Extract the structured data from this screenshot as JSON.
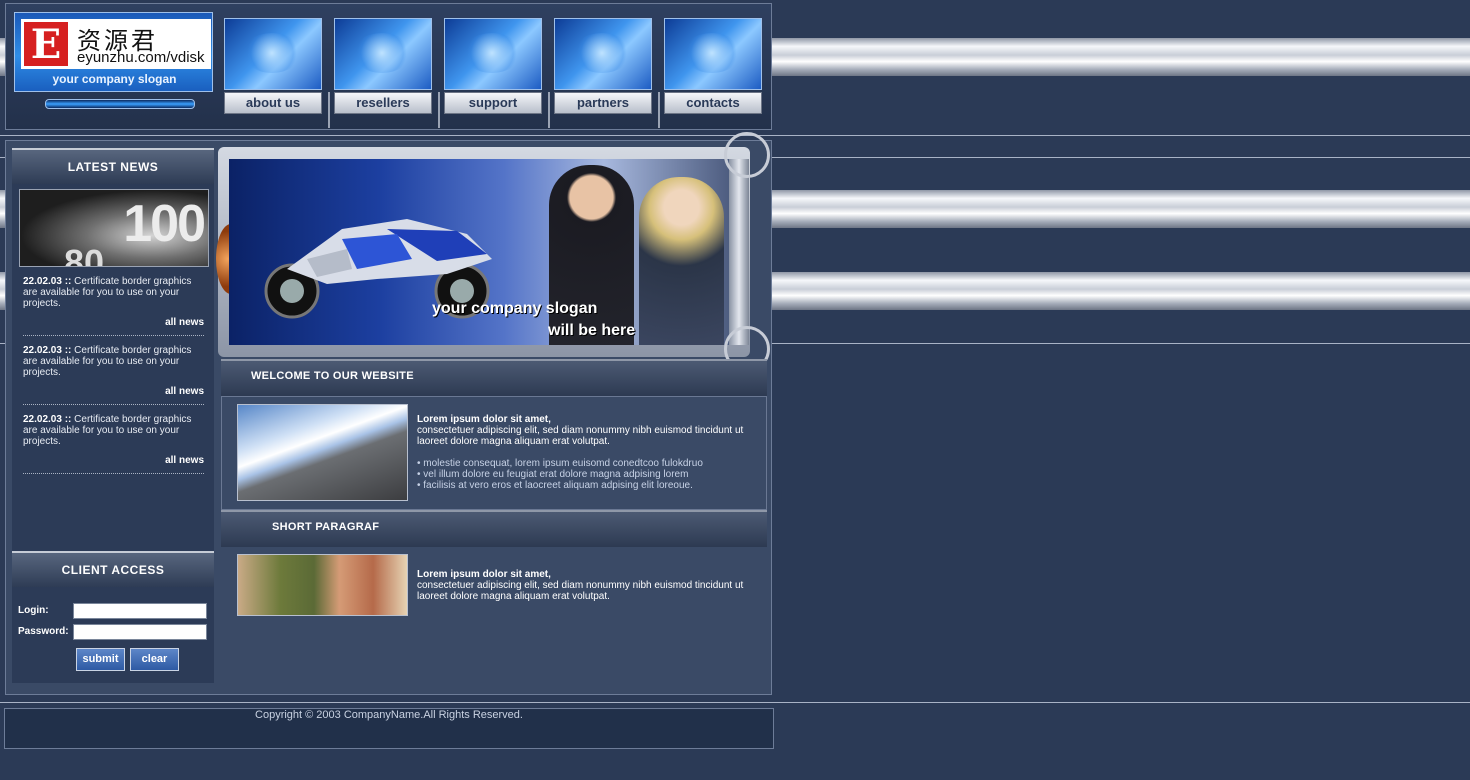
{
  "header": {
    "logo": {
      "letter": "E",
      "chinese": "资源君",
      "url": "eyunzhu.com/vdisk",
      "slogan": "your company slogan"
    },
    "nav": [
      {
        "label": "about us"
      },
      {
        "label": "resellers"
      },
      {
        "label": "support"
      },
      {
        "label": "partners"
      },
      {
        "label": "contacts"
      }
    ]
  },
  "sidebar": {
    "news_title": "LATEST NEWS",
    "news_image": {
      "big": "100",
      "small": "80"
    },
    "news": [
      {
        "date": "22.02.03 ::",
        "text": "Certificate border graphics are available for you to use on your projects.",
        "more": "all news"
      },
      {
        "date": "22.02.03 ::",
        "text": "Certificate border graphics are available for you to use on your projects.",
        "more": "all news"
      },
      {
        "date": "22.02.03 ::",
        "text": "Certificate border graphics are available for you to use on your projects.",
        "more": "all news"
      }
    ],
    "client_title": "CLIENT ACCESS",
    "login_label": "Login:",
    "password_label": "Password:",
    "login_value": "",
    "password_value": "",
    "submit_label": "submit",
    "clear_label": "clear"
  },
  "hero": {
    "slogan_line1": "your company slogan",
    "slogan_line2": "will be here"
  },
  "welcome": {
    "title": "WELCOME TO OUR WEBSITE",
    "heading": "Lorem ipsum dolor sit amet,",
    "body": "consectetuer adipiscing elit, sed diam nonummy nibh euismod tincidunt ut laoreet dolore magna aliquam erat volutpat.",
    "bullets": [
      "• molestie consequat, lorem ipsum euisomd conedtcoo fulokdruo",
      "• vel illum dolore eu feugiat erat dolore magna adpising lorem",
      "• facilisis at vero eros et laocreet aliquam adpising elit loreoue."
    ]
  },
  "short": {
    "title": "SHORT PARAGRAF",
    "heading": "Lorem ipsum dolor sit amet,",
    "body": "consectetuer adipiscing elit, sed diam nonummy nibh euismod tincidunt ut laoreet dolore magna aliquam erat volutpat."
  },
  "footer": {
    "copyright": "Copyright © 2003 CompanyName.All Rights Reserved."
  },
  "colors": {
    "background": "#2b3a56",
    "panel": "#3a4a66",
    "accent_blue": "#2f8ee8",
    "logo_red": "#d62020"
  }
}
